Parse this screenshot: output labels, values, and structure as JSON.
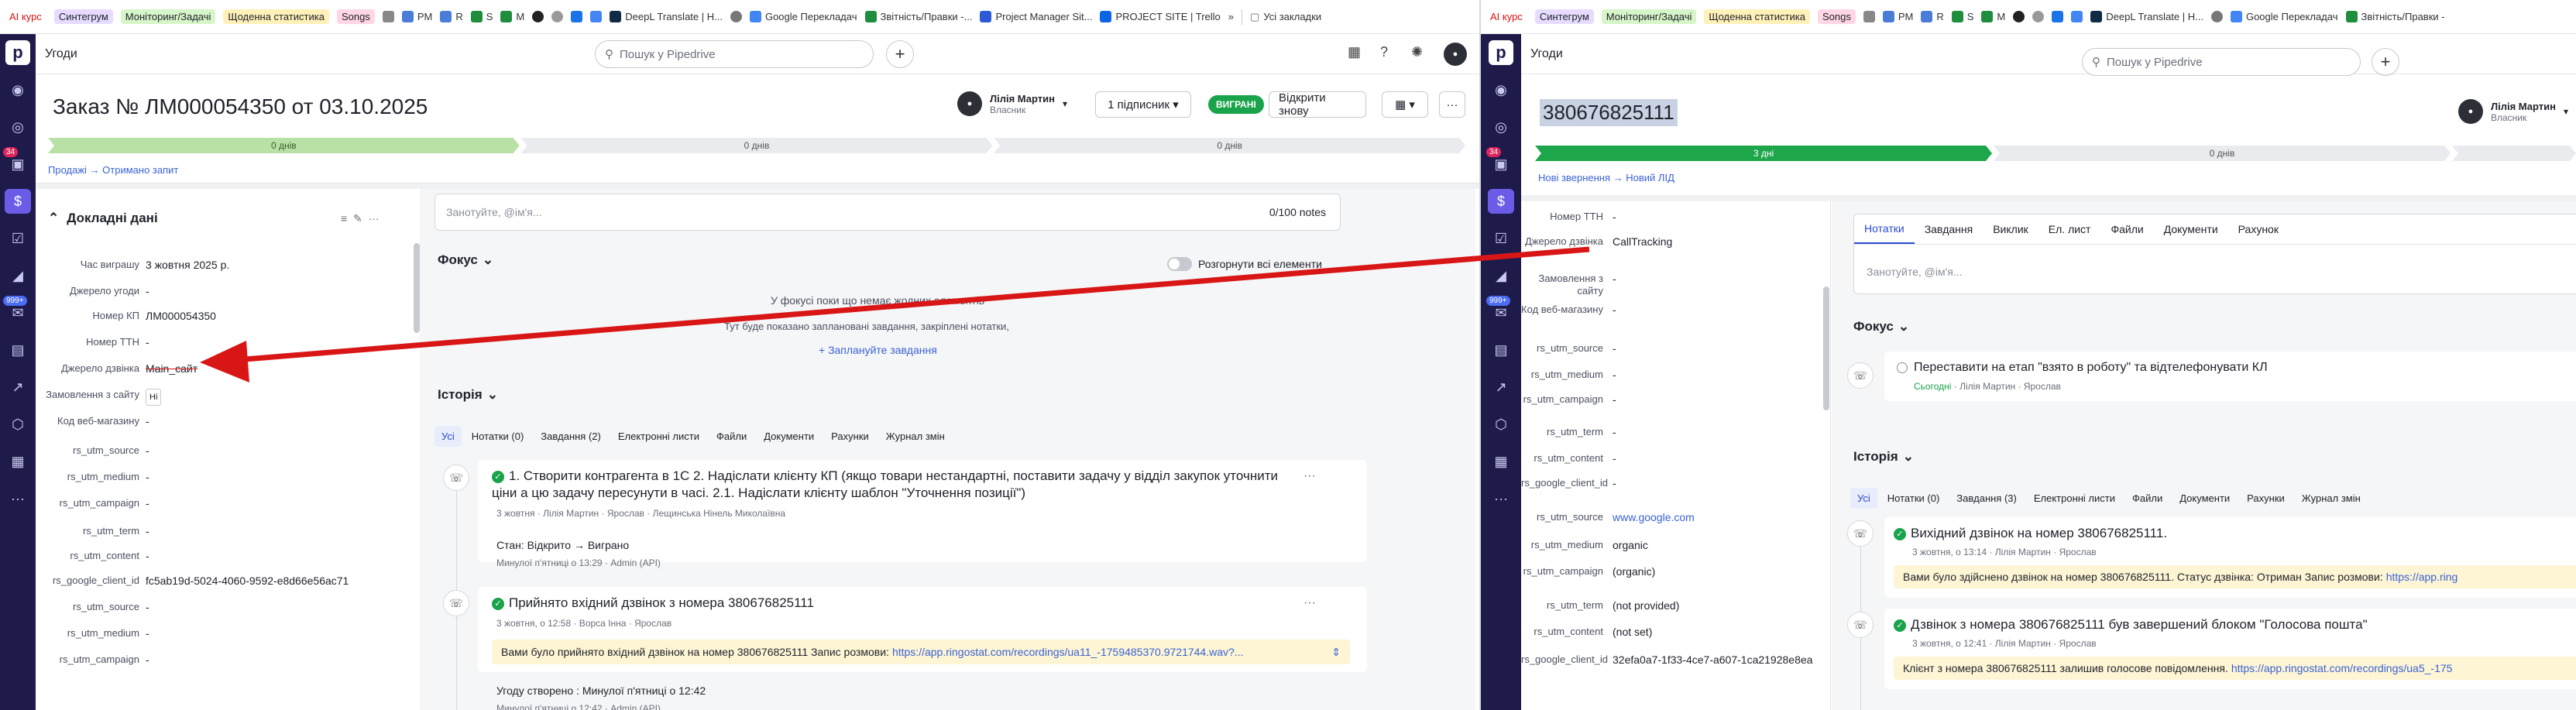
{
  "bookmarks_left": {
    "tag1": "AI курс",
    "tag2": "Синтегрум",
    "tag3": "Моніторинг/Задачі",
    "tag4": "Щоденна статистика",
    "tag5": "Songs",
    "b1": "PM",
    "b2": "R",
    "b3": "S",
    "b4": "M",
    "b5": "DeepL Translate | H...",
    "b6": "Google Перекладач",
    "b7": "Звітність/Правки -...",
    "b8": "Project Manager Sit...",
    "b9": "PROJECT SITE | Trello",
    "more": "»",
    "all": "Усі закладки"
  },
  "bookmarks_right": {
    "tag1": "AI курс",
    "tag2": "Синтегрум",
    "tag3": "Моніторинг/Задачі",
    "tag4": "Щоденна статистика",
    "tag5": "Songs",
    "b1": "PM",
    "b2": "R",
    "b3": "S",
    "b4": "M",
    "b5": "DeepL Translate | H...",
    "b6": "Google Перекладач",
    "b7": "Звітність/Правки -"
  },
  "rail": {
    "logo": "p",
    "badge1": "34",
    "badge2": "999+"
  },
  "left": {
    "section": "Угоди",
    "search_placeholder": "Пошук у Pipedrive",
    "deal_title": "Заказ № ЛМ000054350 от 03.10.2025",
    "owner_name": "Лілія Мартин",
    "owner_role": "Власник",
    "followers": "1 підписник",
    "won": "ВИГРАНІ",
    "reopen": "Відкрити знову",
    "stages": [
      "0 днів",
      "0 днів",
      "0 днів"
    ],
    "crumb1": "Продажі",
    "crumb_arrow": "→",
    "crumb2": "Отримано запит",
    "details_title": "Докладні дані",
    "fields": [
      {
        "label": "Час виграшу",
        "value": "3 жовтня 2025 р."
      },
      {
        "label": "Джерело угоди",
        "value": "-"
      },
      {
        "label": "Номер КП",
        "value": "ЛМ000054350"
      },
      {
        "label": "Номер ТТН",
        "value": "-"
      },
      {
        "label": "Джерело дзвінка",
        "value": "Main_сайт"
      },
      {
        "label": "Замовлення з сайту",
        "value": "Ні"
      },
      {
        "label": "Код веб-магазину",
        "value": "-"
      },
      {
        "label": "rs_utm_source",
        "value": "-"
      },
      {
        "label": "rs_utm_medium",
        "value": "-"
      },
      {
        "label": "rs_utm_campaign",
        "value": "-"
      },
      {
        "label": "rs_utm_term",
        "value": "-"
      },
      {
        "label": "rs_utm_content",
        "value": "-"
      },
      {
        "label": "rs_google_client_id",
        "value": "fc5ab19d-5024-4060-9592-e8d66e56ac71"
      },
      {
        "label": "rs_utm_source",
        "value": "-"
      },
      {
        "label": "rs_utm_medium",
        "value": "-"
      },
      {
        "label": "rs_utm_campaign",
        "value": "-"
      }
    ],
    "note_placeholder": "Занотуйте, @ім'я...",
    "note_counter": "0/100 notes",
    "focus_title": "Фокус",
    "expand_all": "Розгорнути всі елементи",
    "focus_empty1": "У фокусі поки що немає жодних елементів",
    "focus_empty2": "Тут буде показано заплановані завдання, закріплені нотатки,",
    "plan_task": "+ Заплануйте завдання",
    "history_title": "Історія",
    "tabs": [
      "Усі",
      "Нотатки (0)",
      "Завдання (2)",
      "Електронні листи",
      "Файли",
      "Документи",
      "Рахунки",
      "Журнал змін"
    ],
    "h1_title": "1. Створити контрагента в 1С 2. Надіслати клієнту КП (якщо товари нестандартні, поставити задачу у відділ закупок уточнити ціни а цю задачу пересунути в часі. 2.1. Надіслати клієнту шаблон \"Уточнення позиції\")",
    "h1_meta": "3 жовтня · Лілія Мартин  ·  Ярослав  ·  Лещинська Нінель Миколаївна",
    "h2_text": "Стан: Відкрито → Виграно",
    "h2_meta": "Минулої п'ятниці о 13:29 · Admin (API)",
    "h3_title": "Прийнято вхідний дзвінок з номера 380676825111",
    "h3_meta": "3 жовтня, о 12:58 · Ворса Інна  ·  Ярослав",
    "h3_note": "Вами було прийнято вхідний дзвінок на номер 380676825111 Запис розмови:",
    "h3_link": "https://app.ringostat.com/recordings/ua11_-1759485370.9721744.wav?...",
    "h4_text": "Угоду створено : Минулої п'ятниці о 12:42",
    "h4_meta": "Минулої п'ятниці о 12:42 · Admin (API)"
  },
  "right": {
    "section": "Угоди",
    "search_placeholder": "Пошук у Pipedrive",
    "deal_title": "380676825111",
    "owner_name": "Лілія Мартин",
    "owner_role": "Власник",
    "stages": [
      "3 дні",
      "0 днів"
    ],
    "crumb1": "Нові звернення",
    "crumb_arrow": "→",
    "crumb2": "Новий ЛІД",
    "fields": [
      {
        "label": "Номер ТТН",
        "value": "-"
      },
      {
        "label": "Джерело дзвінка",
        "value": "CallTracking"
      },
      {
        "label": "Замовлення з сайту",
        "value": "-"
      },
      {
        "label": "Код веб-магазину",
        "value": "-"
      },
      {
        "label": "rs_utm_source",
        "value": "-"
      },
      {
        "label": "rs_utm_medium",
        "value": "-"
      },
      {
        "label": "rs_utm_campaign",
        "value": "-"
      },
      {
        "label": "rs_utm_term",
        "value": "-"
      },
      {
        "label": "rs_utm_content",
        "value": "-"
      },
      {
        "label": "rs_google_client_id",
        "value": "-"
      },
      {
        "label": "rs_utm_source",
        "value": "www.google.com"
      },
      {
        "label": "rs_utm_medium",
        "value": "organic"
      },
      {
        "label": "rs_utm_campaign",
        "value": "(organic)"
      },
      {
        "label": "rs_utm_term",
        "value": "(not provided)"
      },
      {
        "label": "rs_utm_content",
        "value": "(not set)"
      },
      {
        "label": "rs_google_client_id",
        "value": "32efa0a7-1f33-4ce7-a607-1ca21928e8ea"
      }
    ],
    "tabs": [
      "Нотатки",
      "Завдання",
      "Виклик",
      "Ел. лист",
      "Файли",
      "Документи",
      "Рахунок"
    ],
    "note_placeholder": "Занотуйте, @ім'я...",
    "focus_title": "Фокус",
    "task_title": "Переставити на етап \"взято в роботу\" та відтелефонувати КЛ",
    "task_when": "Сьогодні",
    "task_meta": "· Лілія Мартин  ·  Ярослав",
    "history_title": "Історія",
    "htabs": [
      "Усі",
      "Нотатки (0)",
      "Завдання (3)",
      "Електронні листи",
      "Файли",
      "Документи",
      "Рахунки",
      "Журнал змін"
    ],
    "h1_title": "Вихідний дзвінок на номер 380676825111.",
    "h1_meta": "3 жовтня, о 13:14 · Лілія Мартин  ·  Ярослав",
    "h1_note": "Вами було здійснено дзвінок на номер 380676825111. Статус дзвінка: Отриман Запис розмови:",
    "h1_link": "https://app.ring",
    "h2_title": "Дзвінок з номера 380676825111 був завершений блоком \"Голосова пошта\"",
    "h2_meta": "3 жовтня, о 12:41 · Лілія Мартин  ·  Ярослав",
    "h2_note": "Клієнт з номера 380676825111 залишив голосове повідомлення.",
    "h2_link": "https://app.ringostat.com/recordings/ua5_-175"
  },
  "annotation": {
    "arrow_color": "#d91616"
  }
}
